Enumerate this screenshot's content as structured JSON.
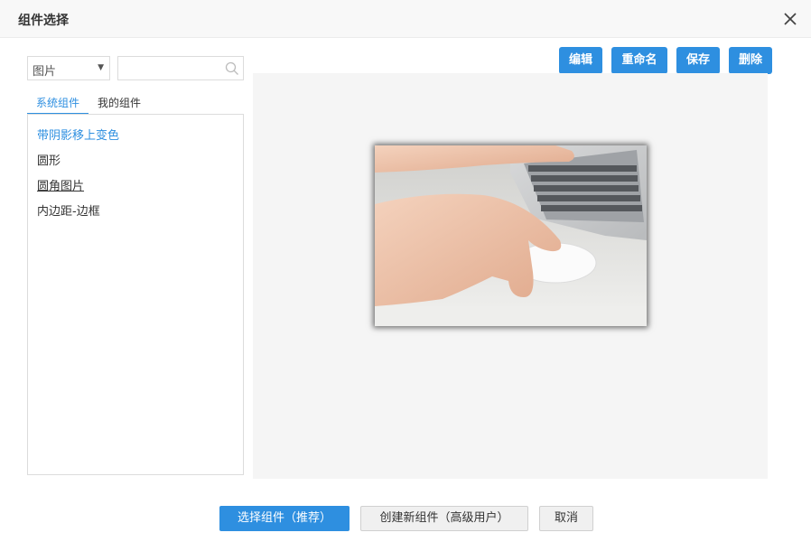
{
  "dialog": {
    "title": "组件选择",
    "close_icon": "close-icon"
  },
  "left": {
    "type_select": {
      "value": "图片",
      "arrow": "▼"
    },
    "search": {
      "value": "",
      "placeholder": "",
      "icon": "search-icon"
    },
    "tabs": [
      {
        "label": "系统组件",
        "active": true
      },
      {
        "label": "我的组件",
        "active": false
      }
    ],
    "items": [
      {
        "label": "带阴影移上变色",
        "active": true
      },
      {
        "label": "圆形",
        "active": false
      },
      {
        "label": "圆角图片",
        "active": false
      },
      {
        "label": "内边距-边框",
        "active": false
      }
    ]
  },
  "toolbar": {
    "edit_label": "编辑",
    "rename_label": "重命名",
    "save_label": "保存",
    "delete_label": "删除"
  },
  "preview": {
    "image_subject": "hand-on-mouse-laptop-photo"
  },
  "footer": {
    "select_label": "选择组件（推荐）",
    "create_label": "创建新组件（高级用户）",
    "cancel_label": "取消"
  },
  "colors": {
    "accent": "#2e8fe0",
    "title_bar": "#f8f8f8",
    "preview_bg": "#f5f5f5"
  }
}
